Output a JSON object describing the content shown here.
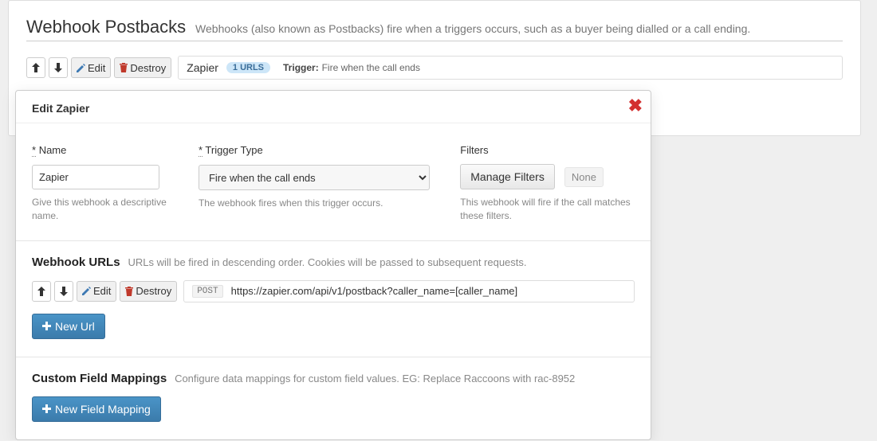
{
  "page": {
    "title": "Webhook Postbacks",
    "subtitle": "Webhooks (also known as Postbacks) fire when a triggers occurs, such as a buyer being dialled or a call ending."
  },
  "buttons": {
    "edit": "Edit",
    "destroy": "Destroy",
    "manage_filters": "Manage Filters",
    "new_url": "New Url",
    "new_field_mapping": "New Field Mapping"
  },
  "webhook_row": {
    "name": "Zapier",
    "badge": "1 URLS",
    "trigger_label": "Trigger:",
    "trigger_value": "Fire when the call ends"
  },
  "modal": {
    "title": "Edit Zapier",
    "name_label": "Name",
    "name_value": "Zapier",
    "name_help": "Give this webhook a descriptive name.",
    "trigger_label": "Trigger Type",
    "trigger_value": "Fire when the call ends",
    "trigger_help": "The webhook fires when this trigger occurs.",
    "filters_label": "Filters",
    "filters_none": "None",
    "filters_help": "This webhook will fire if the call matches these filters."
  },
  "urls_section": {
    "title": "Webhook URLs",
    "subtitle": "URLs will be fired in descending order. Cookies will be passed to subsequent requests.",
    "method": "POST",
    "url": "https://zapier.com/api/v1/postback?caller_name=[caller_name]"
  },
  "mappings_section": {
    "title": "Custom Field Mappings",
    "subtitle": "Configure data mappings for custom field values. EG: Replace Raccoons with rac-8952"
  }
}
